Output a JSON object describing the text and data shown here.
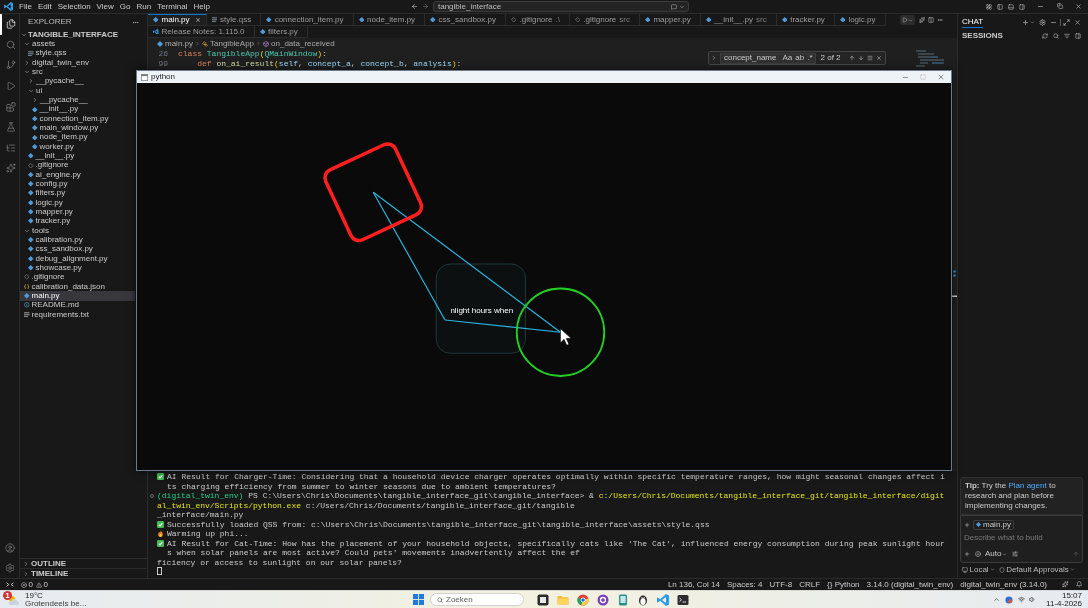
{
  "menu_bar": {
    "items": [
      "File",
      "Edit",
      "Selection",
      "View",
      "Go",
      "Run",
      "Terminal",
      "Help"
    ],
    "command_center": "tangible_interface"
  },
  "activity_bar": [
    {
      "selected": true
    },
    {
      "selected": false
    },
    {
      "selected": false
    },
    {
      "selected": false
    },
    {
      "selected": false
    },
    {
      "selected": false
    },
    {
      "selected": false
    },
    {
      "selected": false
    }
  ],
  "explorer": {
    "title": "EXPLORER",
    "root": {
      "label": "TANGIBLE_INTERFACE",
      "expanded": true
    },
    "tree": [
      {
        "label": "assets",
        "kind": "folder",
        "expanded": true,
        "selected": false,
        "children": [
          {
            "label": "style.qss",
            "kind": "qss",
            "selected": false
          }
        ]
      },
      {
        "label": "digital_twin_env",
        "kind": "folder",
        "expanded": false,
        "selected": false
      },
      {
        "label": "src",
        "kind": "folder",
        "expanded": true,
        "selected": false,
        "children": [
          {
            "label": "__pycache__",
            "kind": "folder",
            "expanded": false,
            "selected": false
          },
          {
            "label": "ui",
            "kind": "folder",
            "expanded": true,
            "selected": false,
            "children": [
              {
                "label": "__pycache__",
                "kind": "folder",
                "expanded": false,
                "selected": false
              },
              {
                "label": "__init__.py",
                "kind": "python",
                "selected": false
              },
              {
                "label": "connection_item.py",
                "kind": "python",
                "selected": false
              },
              {
                "label": "main_window.py",
                "kind": "python",
                "selected": false
              },
              {
                "label": "node_item.py",
                "kind": "python",
                "selected": false
              },
              {
                "label": "worker.py",
                "kind": "python",
                "selected": false
              }
            ]
          },
          {
            "label": "__init__.py",
            "kind": "python",
            "selected": false
          },
          {
            "label": ".gitignore",
            "kind": "git",
            "selected": false
          },
          {
            "label": "ai_engine.py",
            "kind": "python",
            "selected": false
          },
          {
            "label": "config.py",
            "kind": "python",
            "selected": false
          },
          {
            "label": "filters.py",
            "kind": "python",
            "selected": false
          },
          {
            "label": "logic.py",
            "kind": "python",
            "selected": false
          },
          {
            "label": "mapper.py",
            "kind": "python",
            "selected": false
          },
          {
            "label": "tracker.py",
            "kind": "python",
            "selected": false
          }
        ]
      },
      {
        "label": "tools",
        "kind": "folder",
        "expanded": true,
        "selected": false,
        "children": [
          {
            "label": "calibration.py",
            "kind": "python",
            "selected": false
          },
          {
            "label": "css_sandbox.py",
            "kind": "python",
            "selected": false
          },
          {
            "label": "debug_alignment.py",
            "kind": "python",
            "selected": false
          },
          {
            "label": "showcase.py",
            "kind": "python",
            "selected": false
          }
        ]
      },
      {
        "label": ".gitignore",
        "kind": "git",
        "selected": false
      },
      {
        "label": "calibration_data.json",
        "kind": "json",
        "selected": false
      },
      {
        "label": "main.py",
        "kind": "python",
        "selected": true
      },
      {
        "label": "README.md",
        "kind": "md",
        "selected": false
      },
      {
        "label": "requirements.txt",
        "kind": "txt",
        "selected": false
      }
    ],
    "sections": [
      {
        "label": "OUTLINE",
        "expanded": false
      },
      {
        "label": "TIMELINE",
        "expanded": false
      }
    ]
  },
  "editor": {
    "tabs": [
      {
        "label": "main.py",
        "kind": "python",
        "selected": true
      },
      {
        "label": "style.qss",
        "kind": "qss",
        "selected": false
      },
      {
        "label": "connection_item.py",
        "kind": "python",
        "selected": false
      },
      {
        "label": "node_item.py",
        "kind": "python",
        "selected": false
      },
      {
        "label": "css_sandbox.py",
        "kind": "python",
        "selected": false
      },
      {
        "label": ".gitignore",
        "description": ".\\",
        "kind": "git",
        "selected": false
      },
      {
        "label": ".gitignore",
        "description": "src",
        "kind": "git",
        "selected": false
      },
      {
        "label": "mapper.py",
        "kind": "python",
        "selected": false
      },
      {
        "label": "__init__.py",
        "description": "src",
        "kind": "python",
        "selected": false
      },
      {
        "label": "tracker.py",
        "kind": "python",
        "selected": false
      },
      {
        "label": "logic.py",
        "kind": "python",
        "selected": false
      },
      {
        "label": "Release Notes: 1.115.0",
        "kind": "release",
        "selected": false
      },
      {
        "label": "filters.py",
        "kind": "python",
        "selected": false
      }
    ],
    "breadcrumbs": [
      {
        "label": "main.py",
        "kind": "file"
      },
      {
        "label": "TangibleApp",
        "kind": "class"
      },
      {
        "label": "on_data_received",
        "kind": "method"
      }
    ],
    "lines": [
      {
        "number": "26",
        "tokens": [
          {
            "text": "class ",
            "kind": "keyword"
          },
          {
            "text": "TangibleApp",
            "kind": "class"
          },
          {
            "text": "(",
            "kind": "bracket"
          },
          {
            "text": "QMainWindow",
            "kind": "class"
          },
          {
            "text": ")",
            "kind": "bracket"
          },
          {
            "text": ":",
            "kind": "plain"
          }
        ]
      },
      {
        "number": "99",
        "tokens": [
          {
            "text": "    def ",
            "kind": "keyword"
          },
          {
            "text": "on_ai_result",
            "kind": "function"
          },
          {
            "text": "(",
            "kind": "bracket"
          },
          {
            "text": "self",
            "kind": "param"
          },
          {
            "text": ", ",
            "kind": "plain"
          },
          {
            "text": "concept_a",
            "kind": "param"
          },
          {
            "text": ", ",
            "kind": "plain"
          },
          {
            "text": "concept_b",
            "kind": "param"
          },
          {
            "text": ", ",
            "kind": "plain"
          },
          {
            "text": "analysis",
            "kind": "param"
          },
          {
            "text": ")",
            "kind": "bracket"
          },
          {
            "text": ":",
            "kind": "plain"
          }
        ]
      }
    ],
    "find": {
      "value": "concept_name",
      "toggles": [
        "Aa",
        "ab",
        ".*"
      ],
      "count": "2 of 2"
    }
  },
  "python_window": {
    "title": "python",
    "node_label": "nlight hours when"
  },
  "terminal": {
    "lines": [
      {
        "kind": "result",
        "text": "AI Result for Charger-Time: Considering that a household device charger operates optimally within specific temperature ranges, how might seasonal changes affect its charging efficiency from summer to winter seasons due to ambient temperatures?"
      },
      {
        "kind": "prompt",
        "env": "(digital_twin_env)",
        "location": "PS C:\\Users\\Chris\\Documents\\tangible_interface_git\\tangible_interface>",
        "operator": "&",
        "program": "c:/Users/Chris/Documents/tangible_interface_git/tangible_interface/digital_twin_env/Scripts/python.exe",
        "argument": "c:/Users/Chris/Documents/tangible_interface_git/tangible"
      },
      {
        "kind": "plain",
        "text": "_interface/main.py"
      },
      {
        "kind": "result",
        "text": "Successfully loaded QSS from: c:\\Users\\Chris\\Documents\\tangible_interface_git\\tangible_interface\\assets\\style.qss"
      },
      {
        "kind": "warming",
        "text": "Warming up phi..."
      },
      {
        "kind": "result",
        "text": "AI Result for Cat-Time: How has the placement of your household objects, specifically cats like 'The Cat', influenced energy consumption during peak sunlight hours when solar panels are most active? Could pets' movements inadvertently affect the ef"
      },
      {
        "kind": "plain",
        "text": "ficiency or access to sunlight on our solar panels?"
      },
      {
        "kind": "cursor"
      }
    ]
  },
  "chat": {
    "tabs": [
      {
        "label": "CHAT",
        "selected": true
      }
    ],
    "sessions": "SESSIONS",
    "tip": {
      "text": "**Tip:** Try the",
      "link": "Plan agent",
      "rest": "to research and plan before implementing changes."
    },
    "context_file": "main.py",
    "placeholder": "Describe what to build",
    "mode": "Auto",
    "location": "Local",
    "approvals": "Default Approvals"
  },
  "status_bar": {
    "errors": "0",
    "warnings": "0",
    "items": [
      "Ln 136, Col 14",
      "Spaces: 4",
      "UTF-8",
      "CRLF",
      "{} Python",
      "3.14.0 (digital_twin_env)",
      "digital_twin_env (3.14.0)"
    ]
  },
  "taskbar": {
    "weather": {
      "badge": "1",
      "temperature": "19°C",
      "condition": "Grotendeels be..."
    },
    "search": {
      "placeholder": "Zoeken"
    },
    "clock": {
      "time": "15:07",
      "date": "11-4-2026"
    }
  }
}
